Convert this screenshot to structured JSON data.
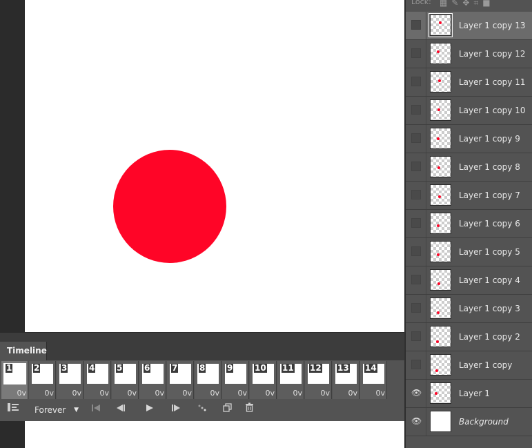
{
  "canvas": {
    "circle_color": "#ff0527"
  },
  "timeline": {
    "tab_label": "Timeline",
    "frames": [
      {
        "num": "1",
        "delay": "0"
      },
      {
        "num": "2",
        "delay": "0"
      },
      {
        "num": "3",
        "delay": "0"
      },
      {
        "num": "4",
        "delay": "0"
      },
      {
        "num": "5",
        "delay": "0"
      },
      {
        "num": "6",
        "delay": "0"
      },
      {
        "num": "7",
        "delay": "0"
      },
      {
        "num": "8",
        "delay": "0"
      },
      {
        "num": "9",
        "delay": "0"
      },
      {
        "num": "10",
        "delay": "0"
      },
      {
        "num": "11",
        "delay": "0"
      },
      {
        "num": "12",
        "delay": "0"
      },
      {
        "num": "13",
        "delay": "0"
      },
      {
        "num": "14",
        "delay": "0"
      }
    ],
    "delay_caret": "v",
    "loop_value": "Forever",
    "controls": {
      "convert_icon": "convert-to-video-timeline-icon",
      "first_frame_icon": "first-frame-icon",
      "prev_frame_icon": "previous-frame-icon",
      "play_icon": "play-icon",
      "next_frame_icon": "next-frame-icon",
      "tween_icon": "tween-icon",
      "duplicate_icon": "duplicate-frame-icon",
      "delete_icon": "delete-frame-icon"
    }
  },
  "layers_panel": {
    "lock_label": "Lock:",
    "layers": [
      {
        "name": "Layer 1 copy 13",
        "visible": false,
        "active": true
      },
      {
        "name": "Layer 1 copy 12",
        "visible": false
      },
      {
        "name": "Layer 1 copy 11",
        "visible": false
      },
      {
        "name": "Layer 1 copy 10",
        "visible": false
      },
      {
        "name": "Layer 1 copy 9",
        "visible": false
      },
      {
        "name": "Layer 1 copy 8",
        "visible": false
      },
      {
        "name": "Layer 1 copy 7",
        "visible": false
      },
      {
        "name": "Layer 1 copy 6",
        "visible": false
      },
      {
        "name": "Layer 1 copy 5",
        "visible": false
      },
      {
        "name": "Layer 1 copy 4",
        "visible": false
      },
      {
        "name": "Layer 1 copy 3",
        "visible": false
      },
      {
        "name": "Layer 1 copy 2",
        "visible": false
      },
      {
        "name": "Layer 1 copy",
        "visible": false
      },
      {
        "name": "Layer 1",
        "visible": true
      },
      {
        "name": "Background",
        "visible": true,
        "italic": true
      }
    ]
  }
}
